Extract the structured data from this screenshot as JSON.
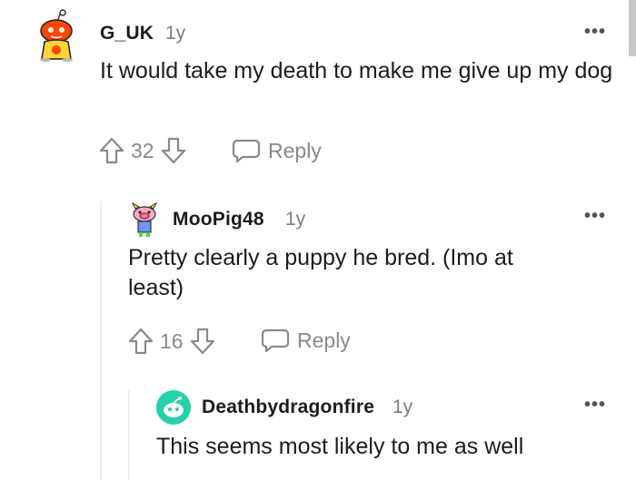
{
  "comments": [
    {
      "username": "G_UK",
      "age": "1y",
      "body": "It would take my death to make me give up my dog",
      "votes": "32",
      "reply_label": "Reply",
      "avatar_icon": "snoo-avatar-icon"
    },
    {
      "username": "MooPig48",
      "age": "1y",
      "body": "Pretty clearly a puppy he bred. (Imo at least)",
      "votes": "16",
      "reply_label": "Reply",
      "avatar_icon": "pig-avatar-icon"
    },
    {
      "username": "Deathbydragonfire",
      "age": "1y",
      "body": "This seems most likely to me as well",
      "avatar_icon": "snoo-green-avatar-icon"
    }
  ],
  "colors": {
    "thread_line": "#edeff1",
    "meta_gray": "#878a8c",
    "text": "#1c1c1c",
    "orange_avatar": "#ff4500",
    "teal_avatar": "#24d1a8"
  }
}
